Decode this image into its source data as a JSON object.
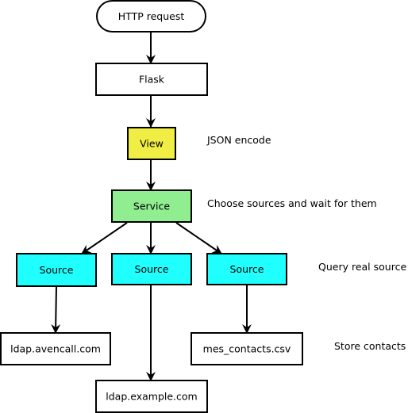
{
  "colors": {
    "stroke": "#000000",
    "default_fill": "#ffffff",
    "view_fill": "#f0ee44",
    "service_fill": "#90ee90",
    "source_fill": "#1ffffe"
  },
  "nodes": [
    {
      "id": "http",
      "label": "HTTP request",
      "shape": "pill",
      "fill": "#ffffff"
    },
    {
      "id": "flask",
      "label": "Flask",
      "shape": "rect",
      "fill": "#ffffff"
    },
    {
      "id": "view",
      "label": "View",
      "shape": "rect",
      "fill": "#f0ee44"
    },
    {
      "id": "service",
      "label": "Service",
      "shape": "rect",
      "fill": "#90ee90"
    },
    {
      "id": "source1",
      "label": "Source",
      "shape": "rect",
      "fill": "#1ffffe"
    },
    {
      "id": "source2",
      "label": "Source",
      "shape": "rect",
      "fill": "#1ffffe"
    },
    {
      "id": "source3",
      "label": "Source",
      "shape": "rect",
      "fill": "#1ffffe"
    },
    {
      "id": "ldap_avencall",
      "label": "ldap.avencall.com",
      "shape": "rect",
      "fill": "#ffffff"
    },
    {
      "id": "ldap_example",
      "label": "ldap.example.com",
      "shape": "rect",
      "fill": "#ffffff"
    },
    {
      "id": "mes_contacts",
      "label": "mes_contacts.csv",
      "shape": "rect",
      "fill": "#ffffff"
    }
  ],
  "edges": [
    {
      "from": "http",
      "to": "flask"
    },
    {
      "from": "flask",
      "to": "view"
    },
    {
      "from": "view",
      "to": "service"
    },
    {
      "from": "service",
      "to": "source1"
    },
    {
      "from": "service",
      "to": "source2"
    },
    {
      "from": "service",
      "to": "source3"
    },
    {
      "from": "source1",
      "to": "ldap_avencall"
    },
    {
      "from": "source2",
      "to": "ldap_example"
    },
    {
      "from": "source3",
      "to": "mes_contacts"
    }
  ],
  "annotations": [
    {
      "id": "json",
      "text": "JSON encode"
    },
    {
      "id": "choose",
      "text": "Choose sources and wait for them"
    },
    {
      "id": "query",
      "text": "Query real source"
    },
    {
      "id": "store",
      "text": "Store contacts"
    }
  ]
}
